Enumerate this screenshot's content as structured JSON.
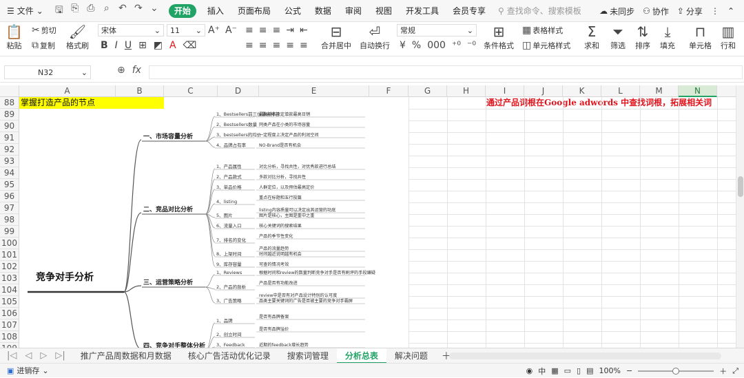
{
  "menubar": {
    "file_label": "文件",
    "tabs": [
      "开始",
      "插入",
      "页面布局",
      "公式",
      "数据",
      "审阅",
      "视图",
      "开发工具",
      "会员专享"
    ],
    "search_placeholder": "查找命令、搜索模板",
    "sync_label": "未同步",
    "collab_label": "协作",
    "share_label": "分享"
  },
  "ribbon": {
    "cut": "剪切",
    "paste": "粘贴",
    "copy": "复制",
    "format_painter": "格式刷",
    "font_name": "宋体",
    "font_size": "11",
    "merge": "合并居中",
    "wrap": "自动换行",
    "number_format": "常规",
    "cond_format": "条件格式",
    "table_style": "表格样式",
    "cell_style": "单元格样式",
    "sum": "求和",
    "filter": "筛选",
    "sort": "排序",
    "fill": "填充",
    "cells": "单元格",
    "rows_cols": "行和"
  },
  "formula_bar": {
    "name_box": "N32",
    "formula": ""
  },
  "columns": [
    "A",
    "B",
    "C",
    "D",
    "E",
    "F",
    "G",
    "H",
    "I",
    "J",
    "K",
    "L",
    "M",
    "N"
  ],
  "rows": [
    "88",
    "89",
    "90",
    "91",
    "92",
    "93",
    "94",
    "95",
    "96",
    "97",
    "98",
    "99",
    "100",
    "101",
    "102",
    "103",
    "104",
    "105",
    "106",
    "107",
    "108",
    "109",
    "110"
  ],
  "cells": {
    "A88": "掌握打造产品的节点",
    "H88": "通过产品词根在Google adwords 中查找词根，拓展相关词"
  },
  "mindmap": {
    "root": "竞争对手分析",
    "branches": [
      {
        "label": "一、市场容量分析",
        "items": [
          {
            "label": "1、Bestsellers前三位最高排名",
            "note": "最高排名决定单款最高日销"
          },
          {
            "label": "2、Bestsellers数量",
            "note": "同类产品在小类的市场容量"
          },
          {
            "label": "3、bestsellers的均价",
            "note": "一定程度上决定产品的利润空间"
          },
          {
            "label": "4、品牌占有率",
            "note": "NO-Brand是否有机会"
          }
        ]
      },
      {
        "label": "二、竞品对比分析",
        "items": [
          {
            "label": "1、产品属性",
            "note": "对比分析，寻找共性，对优秀款进行总结"
          },
          {
            "label": "2、产品款式",
            "note": "多款对比分析，寻找共性"
          },
          {
            "label": "3、单品价格",
            "note": "人群定位，以及预估最高定价"
          },
          {
            "label": "4、listing",
            "note": "重点在标题和五行投篇",
            "note2": "listing内容质量可以决定出其运营的功底"
          },
          {
            "label": "5、图片",
            "note": "图片是核心，主图是重中之重"
          },
          {
            "label": "6、流量入口",
            "note": "核心关键词的搜索结果"
          },
          {
            "label": "7、排名的变化",
            "note": "产品的季节性变化",
            "note2": "产品的流量趋势"
          },
          {
            "label": "8、上架时间",
            "note": "时间越近说明越有机会"
          },
          {
            "label": "9、库存容量",
            "note": "可查的情况考效"
          }
        ]
      },
      {
        "label": "三、运营策略分析",
        "items": [
          {
            "label": "1、Reviews",
            "note": "根据时间和review的数量判断竞争对手是否有刷评的手段嫌疑"
          },
          {
            "label": "2、产品的剖析",
            "note": "产品是否有功能改进",
            "note2": "review中是否有对产品设计特别的认可度"
          },
          {
            "label": "3、广告策略",
            "note": "品类主要关键词的广告是否被主要的竞争对手霸屏"
          }
        ]
      },
      {
        "label": "四、竞争对手整体分析",
        "items": [
          {
            "label": "1、品牌",
            "note": "是否有品牌备案",
            "note2": "是否有品牌溢价"
          },
          {
            "label": "2、创立时间",
            "note": ""
          },
          {
            "label": "3、Feedback",
            "note": "近期的feedback增长趋势"
          }
        ]
      }
    ]
  },
  "sheet_tabs": [
    "推广产品周数据和月数据",
    "核心广告活动优化记录",
    "搜索词管理",
    "分析总表",
    "解决问题"
  ],
  "active_sheet": "分析总表",
  "status": {
    "macro": "进销存",
    "zoom": "100%"
  },
  "accent_color": "#21a366"
}
